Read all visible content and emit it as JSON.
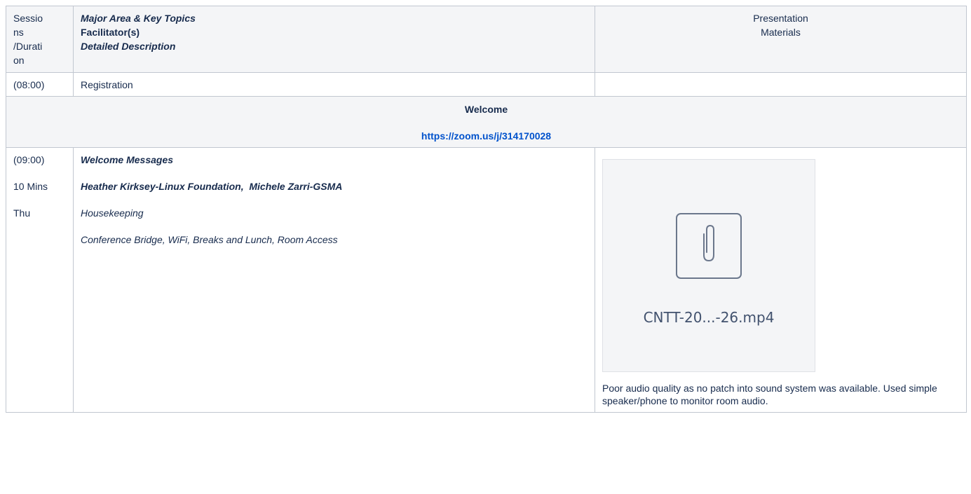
{
  "header": {
    "col1": [
      "Sessio",
      "ns",
      "/Durati",
      "on"
    ],
    "col2": {
      "major_area": "Major Area & Key Topics",
      "facilitators": "Facilitator(s)",
      "detailed": "Detailed Description"
    },
    "col3": {
      "line1": "Presentation",
      "line2": "Materials"
    }
  },
  "rows": {
    "registration": {
      "time": "(08:00)",
      "topic": "Registration",
      "materials": ""
    },
    "welcome_section": {
      "title": "Welcome",
      "link": "https://zoom.us/j/314170028"
    },
    "welcome_messages": {
      "time": "(09:00)",
      "duration": "10 Mins",
      "day": "Thu",
      "title": "Welcome Messages",
      "facilitators": "Heather Kirksey-Linux Foundation,  Michele Zarri-GSMA",
      "subtitle": "Housekeeping",
      "description": "Conference Bridge, WiFi, Breaks and Lunch, Room Access",
      "attachment": {
        "filename": "CNTT-20...-26.mp4",
        "icon": "paperclip-icon"
      },
      "note": "Poor audio quality as no patch into sound system was available. Used simple speaker/phone to monitor room audio."
    }
  },
  "colors": {
    "border": "#c1c7d0",
    "header_bg": "#f4f5f7",
    "link": "#0052cc",
    "text": "#172b4d"
  }
}
